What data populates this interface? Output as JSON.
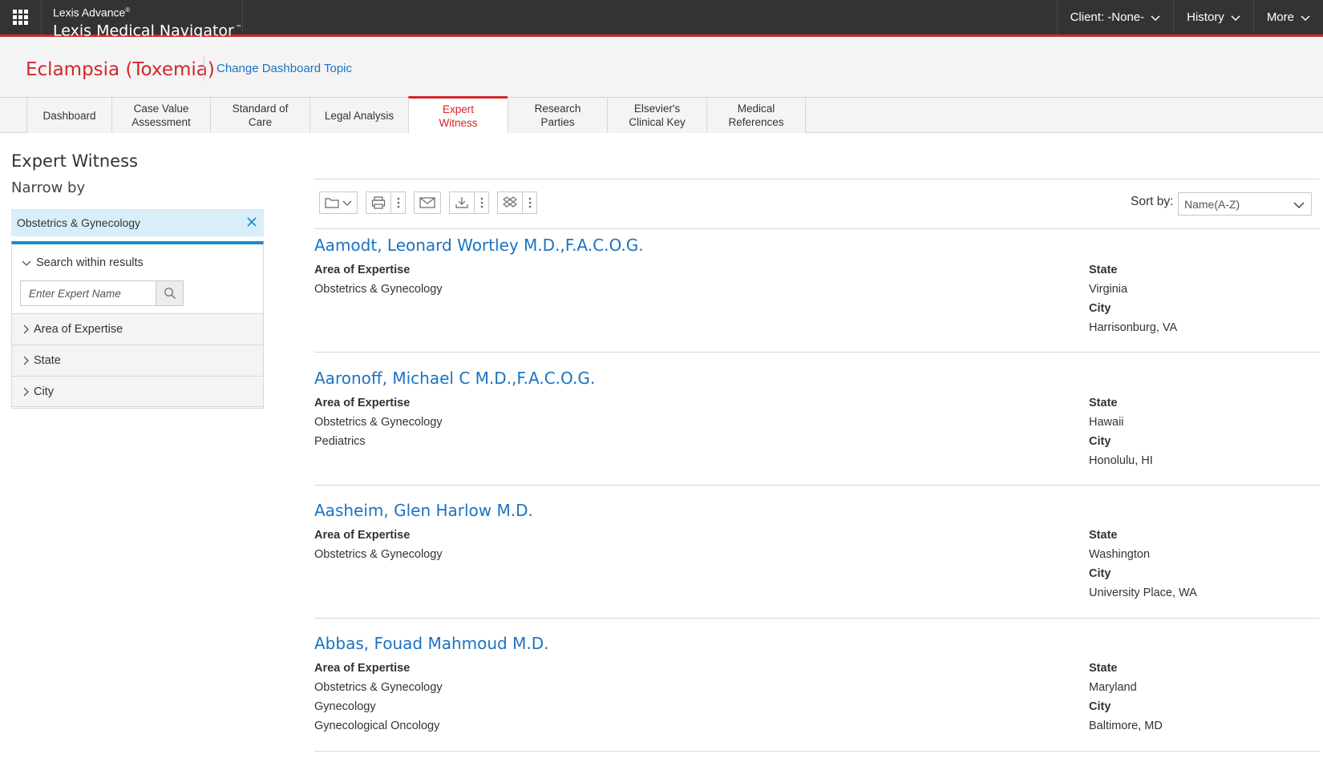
{
  "topbar": {
    "brand_top": "Lexis Advance",
    "brand_reg": "®",
    "brand_main": "Lexis Medical Navigator",
    "brand_tm": "™",
    "nav": [
      {
        "label": "Client: -None-"
      },
      {
        "label": "History"
      },
      {
        "label": "More"
      }
    ]
  },
  "header": {
    "topic": "Eclampsia (Toxemia)",
    "change_topic": "Change Dashboard Topic"
  },
  "tabs": [
    {
      "line1": "Dashboard",
      "line2": ""
    },
    {
      "line1": "Case Value",
      "line2": "Assessment"
    },
    {
      "line1": "Standard of",
      "line2": "Care"
    },
    {
      "line1": "Legal Analysis",
      "line2": ""
    },
    {
      "line1": "Expert",
      "line2": "Witness"
    },
    {
      "line1": "Research",
      "line2": "Parties"
    },
    {
      "line1": "Elsevier's",
      "line2": "Clinical Key"
    },
    {
      "line1": "Medical",
      "line2": "References"
    }
  ],
  "sidebar": {
    "title": "Expert Witness",
    "narrow_by": "Narrow by",
    "active_filter": "Obstetrics & Gynecology",
    "search_within": "Search within results",
    "search_placeholder": "Enter Expert Name",
    "facets": [
      "Area of Expertise",
      "State",
      "City"
    ]
  },
  "toolbar": {
    "sort_label": "Sort by:",
    "sort_value": "Name(A-Z)"
  },
  "labels": {
    "area": "Area of Expertise",
    "state": "State",
    "city": "City"
  },
  "results": [
    {
      "name": "Aamodt, Leonard Wortley M.D.,F.A.C.O.G.",
      "areas": [
        "Obstetrics & Gynecology"
      ],
      "state": "Virginia",
      "city": "Harrisonburg, VA"
    },
    {
      "name": "Aaronoff, Michael C M.D.,F.A.C.O.G.",
      "areas": [
        "Obstetrics & Gynecology",
        "Pediatrics"
      ],
      "state": "Hawaii",
      "city": "Honolulu, HI"
    },
    {
      "name": "Aasheim, Glen Harlow M.D.",
      "areas": [
        "Obstetrics & Gynecology"
      ],
      "state": "Washington",
      "city": "University Place, WA"
    },
    {
      "name": "Abbas, Fouad Mahmoud M.D.",
      "areas": [
        "Obstetrics & Gynecology",
        "Gynecology",
        "Gynecological Oncology"
      ],
      "state": "Maryland",
      "city": "Baltimore, MD"
    }
  ],
  "colors": {
    "accent_red": "#d3262b",
    "link_blue": "#1a73c3",
    "topbar_bg": "#333333",
    "filter_chip_bg": "#d8eef9"
  },
  "icons": [
    "apps-grid-icon",
    "chevron-down-icon",
    "close-icon",
    "search-icon",
    "folder-icon",
    "print-icon",
    "more-vertical-icon",
    "email-icon",
    "download-icon",
    "dropbox-icon",
    "chevron-right-icon"
  ]
}
